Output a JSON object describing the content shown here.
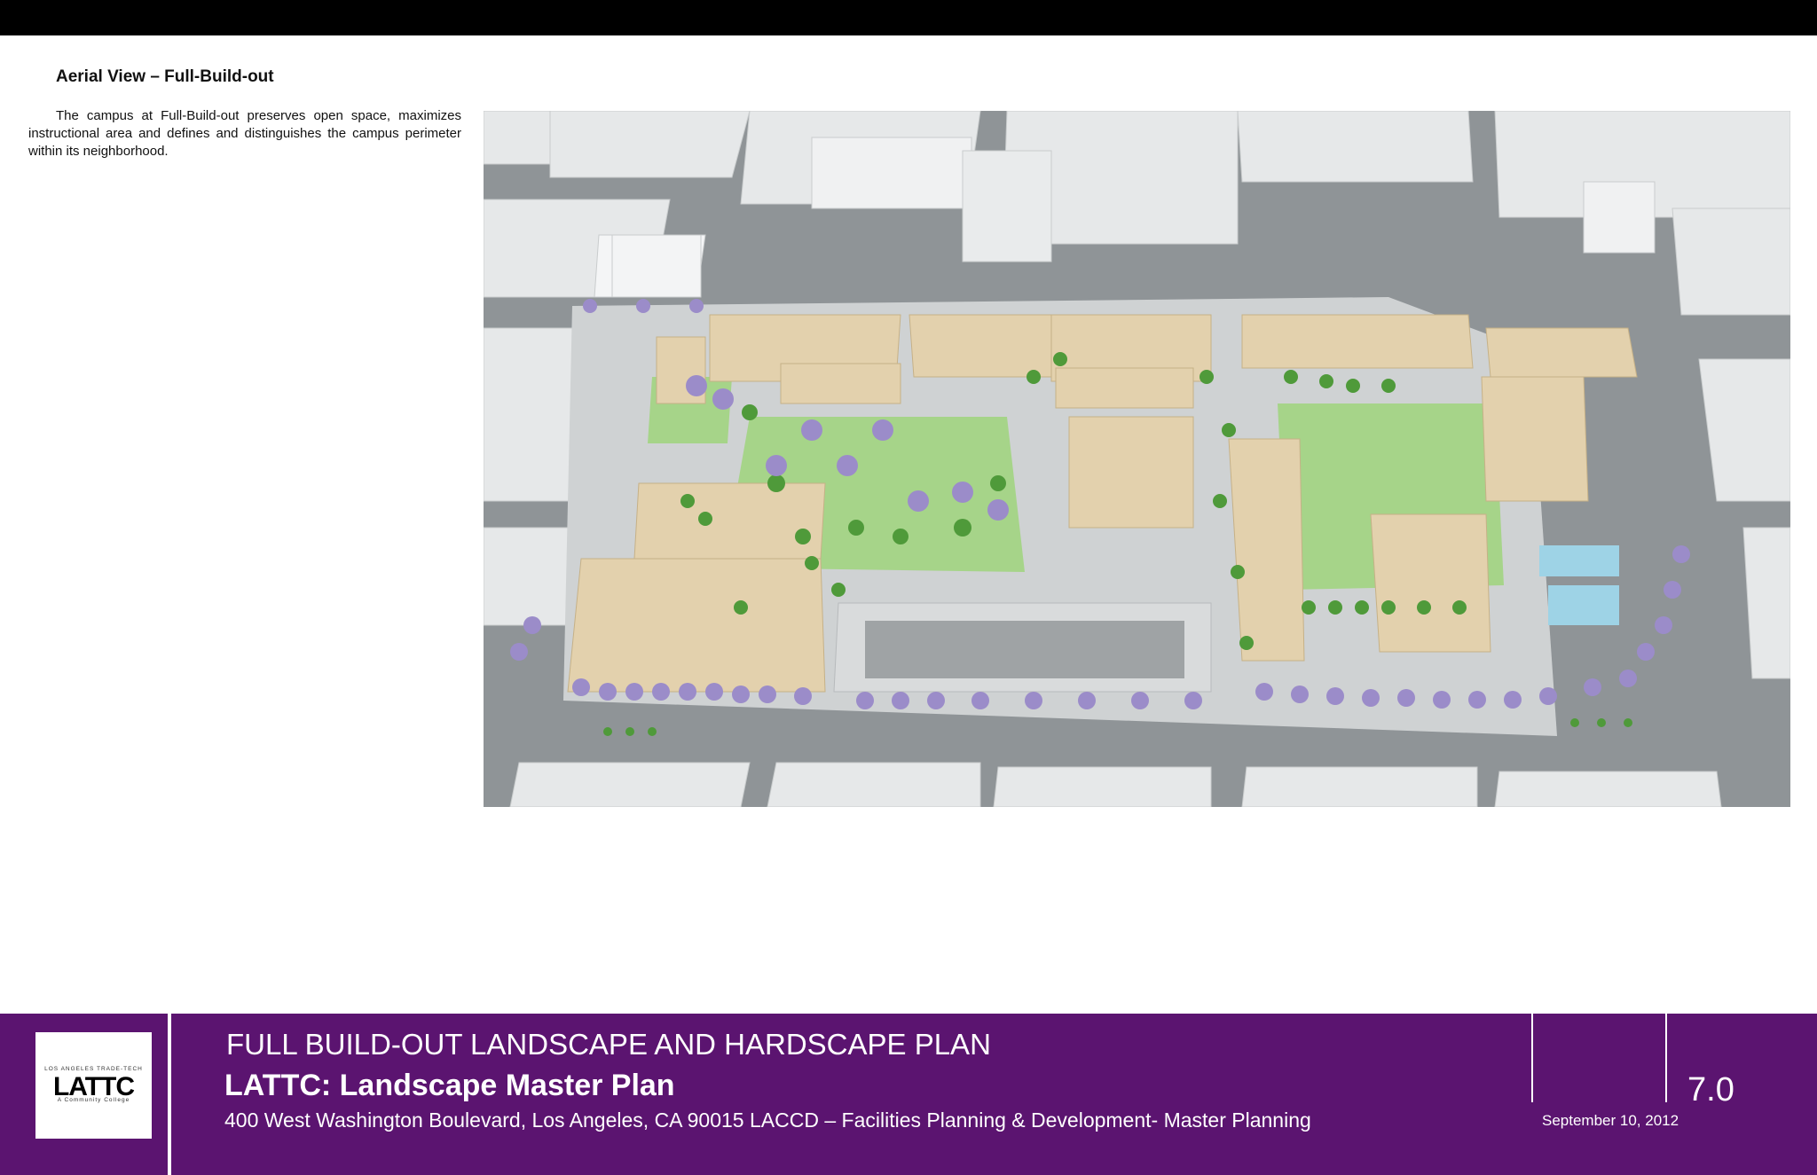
{
  "slide": {
    "heading": "Aerial View – Full-Build-out",
    "intro": "The campus at Full-Build-out preserves open space, maximizes instructional area and defines and distinguishes the campus perimeter within its neighborhood."
  },
  "image": {
    "subject": "aerial-rendering",
    "colors": {
      "road": "#8f9497",
      "building": "#e4e6e7",
      "campus_building": "#e3d1ad",
      "lawn": "#a6d489",
      "tree": "#4f9a3a",
      "jacaranda": "#9b8cc9",
      "pool": "#9ed3e6"
    }
  },
  "footer": {
    "logo_top": "LOS ANGELES TRADE-TECH",
    "logo_main": "LATTC",
    "logo_bottom": "A Community College",
    "title": "FULL BUILD-OUT LANDSCAPE AND HARDSCAPE PLAN",
    "subtitle": "LATTC: Landscape Master Plan",
    "address": "400 West Washington Boulevard, Los Angeles, CA 90015  LACCD – Facilities Planning & Development- Master Planning",
    "date": "September 10, 2012",
    "page": "7.0",
    "background": "#5b1470"
  }
}
